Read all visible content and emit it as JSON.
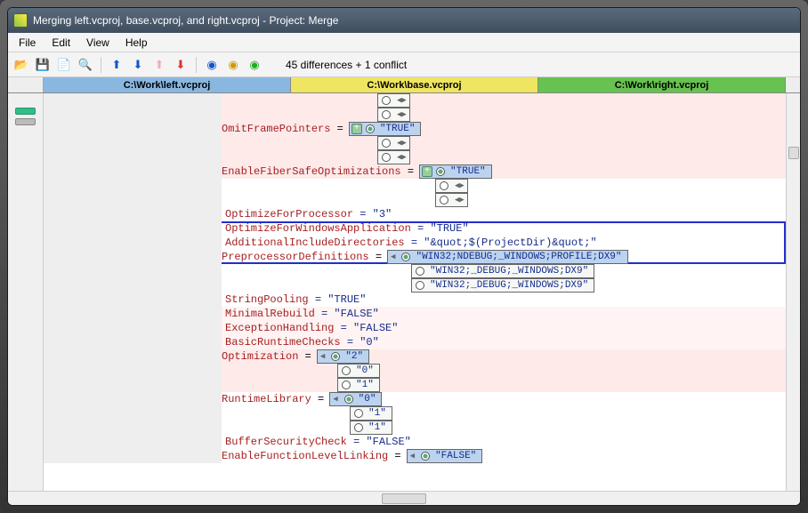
{
  "window": {
    "title": "Merging left.vcproj, base.vcproj, and right.vcproj - Project: Merge"
  },
  "menu": {
    "file": "File",
    "edit": "Edit",
    "view": "View",
    "help": "Help"
  },
  "toolbar": {
    "status": "45 differences + 1 conflict"
  },
  "columns": {
    "left": "C:\\Work\\left.vcproj",
    "base": "C:\\Work\\base.vcproj",
    "right": "C:\\Work\\right.vcproj"
  },
  "rows": {
    "omitFramePointers": {
      "attr": "OmitFramePointers",
      "eq": " = ",
      "sel": "\"TRUE\""
    },
    "enableFiberSafe": {
      "attr": "EnableFiberSafeOptimizations",
      "eq": " = ",
      "sel": "\"TRUE\""
    },
    "optForProc": {
      "attr": "OptimizeForProcessor",
      "rest": " = \"3\""
    },
    "optForWin": {
      "attr": "OptimizeForWindowsApplication",
      "rest": " = \"TRUE\""
    },
    "addlInc": {
      "attr": "AdditionalIncludeDirectories",
      "rest": " = \"&quot;$(ProjectDir)&quot;\""
    },
    "preproc": {
      "attr": "PreprocessorDefinitions",
      "eq": " = ",
      "v1": "\"WIN32;NDEBUG;_WINDOWS;PROFILE;DX9\"",
      "v2": "\"WIN32;_DEBUG;_WINDOWS;DX9\"",
      "v3": "\"WIN32;_DEBUG;_WINDOWS;DX9\""
    },
    "stringPooling": {
      "attr": "StringPooling",
      "rest": " = \"TRUE\""
    },
    "minRebuild": {
      "attr": "MinimalRebuild",
      "rest": " = \"FALSE\""
    },
    "excHandling": {
      "attr": "ExceptionHandling",
      "rest": " = \"FALSE\""
    },
    "basicRuntime": {
      "attr": "BasicRuntimeChecks",
      "rest": " = \"0\""
    },
    "optimization": {
      "attr": "Optimization",
      "eq": " = ",
      "v1": "\"2\"",
      "v2": "\"0\"",
      "v3": "\"1\""
    },
    "runtimeLib": {
      "attr": "RuntimeLibrary",
      "eq": " = ",
      "v1": "\"0\"",
      "v2": "\"1\"",
      "v3": "\"1\""
    },
    "bufSecCheck": {
      "attr": "BufferSecurityCheck",
      "rest": " = \"FALSE\""
    },
    "enableFuncLink": {
      "attr": "EnableFunctionLevelLinking",
      "eq": " = ",
      "sel": "\"FALSE\""
    }
  }
}
